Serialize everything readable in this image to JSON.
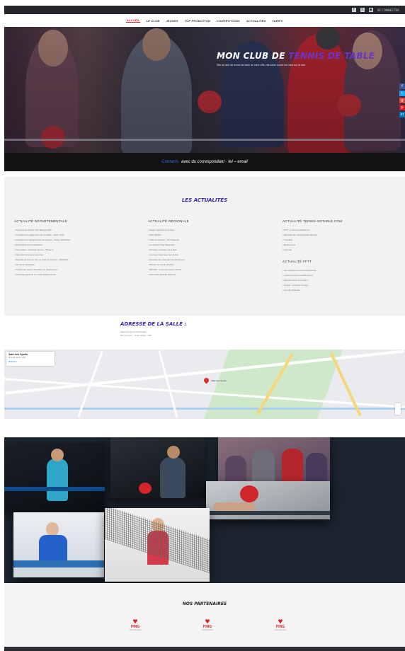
{
  "topbar": {
    "social": [
      "f",
      "𝕏",
      "▣"
    ],
    "login": "SE CONNECTER"
  },
  "nav": {
    "items": [
      {
        "label": "Accueil",
        "active": true
      },
      {
        "label": "Le Club",
        "active": false
      },
      {
        "label": "Jeunes",
        "active": false
      },
      {
        "label": "Top Promotion",
        "active": false
      },
      {
        "label": "Compétitions",
        "active": false
      },
      {
        "label": "Actualités",
        "active": false
      },
      {
        "label": "Tarifs",
        "active": false
      }
    ]
  },
  "hero": {
    "title_part1": "Mon Club de ",
    "title_accent": "Tennis de Table",
    "subtitle": "Site du club de tennis de table de votre ville, retrouvez toutes les infos sur le club",
    "side_social": [
      {
        "glyph": "f",
        "color": "#3b5998"
      },
      {
        "glyph": "t",
        "color": "#1da1f2"
      },
      {
        "glyph": "g",
        "color": "#dd4b39"
      },
      {
        "glyph": "p",
        "color": "#cb2027"
      },
      {
        "glyph": "in",
        "color": "#0077b5"
      }
    ]
  },
  "strip": {
    "highlight": "Contacts",
    "text": "avec du correspondant · tel – email"
  },
  "news": {
    "title": "Les actualités",
    "columns": [
      {
        "heading": "Actualité Départementale",
        "items": [
          "Vainqueur du Premier Tour Equipes 2021",
          "Inscription aux stages d'été Jeunes Mixte – 2020 / 2021",
          "Inscription aux championnats par équipes – Saison 2020/2021",
          "Réinscription aux compétitions",
          "Convocation : Interclubs Jeunes – Phase 1",
          "Calendrier de la saison sportive",
          "Résultats du Premier Tour du Critérium Fédéral – 2020/2021",
          "Tournoi de l'épiphanie",
          "Trophée des Jeunes Pongistes du département",
          "Assemblée générale du comité départemental"
        ]
      },
      {
        "heading": "Actualité Régionale",
        "items": [
          "Stages régionaux de la ligue",
          "PING SPORT",
          "Critérium Fédéral – Tour Régional",
          "Les Coupes Ping Régionales",
          "Formation technique de la ligue",
          "Journées Régionales des Jeunes",
          "Résultats des Championnats Régionaux",
          "Réunion du comité directeur",
          "RÉGION : le suivi des jeunes talents",
          "Assemblée générale régionale"
        ]
      },
      {
        "heading": "Actualité Tennis-Sdtable.com",
        "items": [
          "WTT : le circuit professionnel",
          "Résultats des championnats d'Europe",
          "Transferts",
          "Equipements",
          "Interview"
        ],
        "heading2": "Actualité FFTT",
        "items2": [
          "Les Français au tournoi international",
          "Lancement de la nouvelle licence",
          "Agenda fédéral de la saison",
          "Dossier : l'évolution du ping",
          "La Lettre Fédérale"
        ]
      }
    ]
  },
  "address": {
    "title": "Adresse de la salle :",
    "line1": "Salle des sports Municipale",
    "line2": "Rue du sport · Code postal · Ville"
  },
  "map": {
    "card_title": "Salle des Sports",
    "card_sub": "Rue du sport, Ville",
    "card_link": "Itinéraire",
    "pin_label": "Salle des Sports"
  },
  "partners": {
    "title": "Nos partenaires",
    "logos": [
      {
        "heart": "♥",
        "text": "PING",
        "sub": "club partenaire"
      },
      {
        "heart": "♥",
        "text": "PING",
        "sub": "club partenaire"
      },
      {
        "heart": "♥",
        "text": "PING",
        "sub": "club partenaire"
      }
    ]
  }
}
